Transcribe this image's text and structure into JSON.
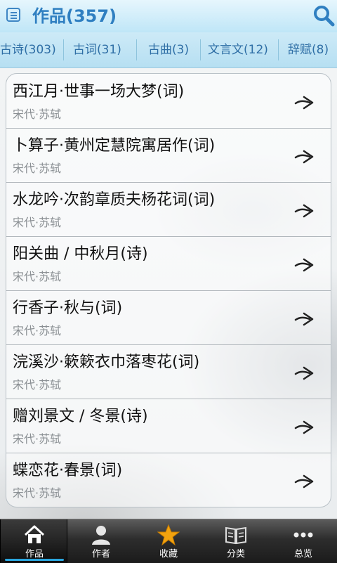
{
  "header": {
    "title": "作品(357)",
    "menu_icon": "menu-icon",
    "search_icon": "search-icon",
    "accent_color": "#2f7fc1"
  },
  "tabs": [
    {
      "label": "古诗(303)"
    },
    {
      "label": "古词(31)"
    },
    {
      "label": "古曲(3)"
    },
    {
      "label": "文言文(12)"
    },
    {
      "label": "辞赋(8)"
    }
  ],
  "works": [
    {
      "title": "西江月·世事一场大梦(词)",
      "author": "宋代·苏轼"
    },
    {
      "title": "卜算子·黄州定慧院寓居作(词)",
      "author": "宋代·苏轼"
    },
    {
      "title": "水龙吟·次韵章质夫杨花词(词)",
      "author": "宋代·苏轼"
    },
    {
      "title": "阳关曲 / 中秋月(诗)",
      "author": "宋代·苏轼"
    },
    {
      "title": "行香子·秋与(词)",
      "author": "宋代·苏轼"
    },
    {
      "title": "浣溪沙·簌簌衣巾落枣花(词)",
      "author": "宋代·苏轼"
    },
    {
      "title": "赠刘景文 / 冬景(诗)",
      "author": "宋代·苏轼"
    },
    {
      "title": "蝶恋花·春景(词)",
      "author": "宋代·苏轼"
    }
  ],
  "nav": [
    {
      "label": "作品",
      "icon": "home-icon",
      "active": true
    },
    {
      "label": "作者",
      "icon": "person-icon",
      "active": false
    },
    {
      "label": "收藏",
      "icon": "star-icon",
      "active": false
    },
    {
      "label": "分类",
      "icon": "book-icon",
      "active": false
    },
    {
      "label": "总览",
      "icon": "more-icon",
      "active": false
    }
  ]
}
